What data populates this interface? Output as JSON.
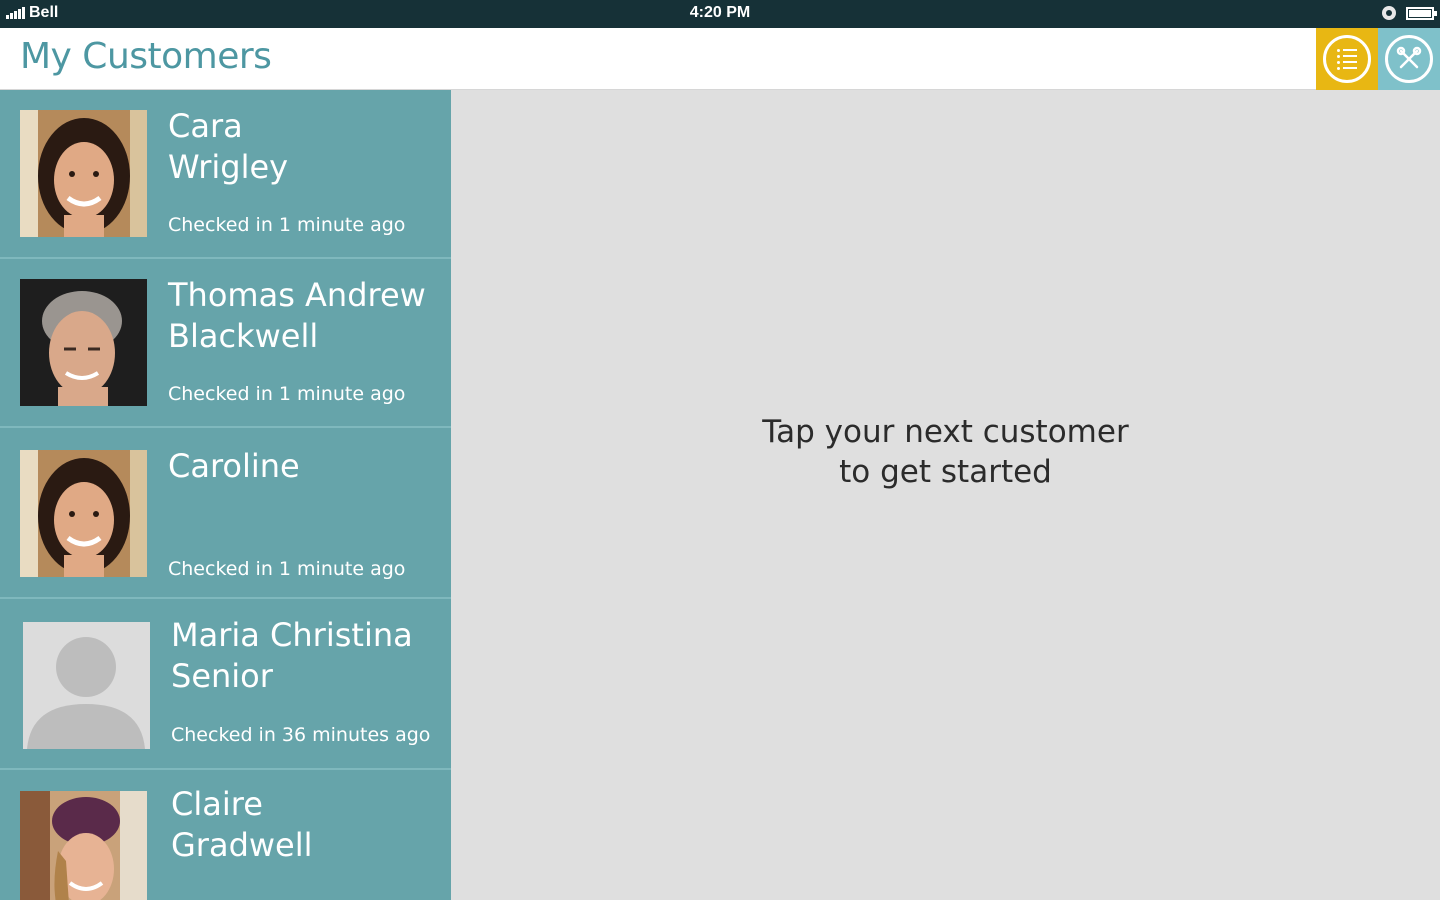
{
  "status_bar": {
    "carrier": "Bell",
    "time": "4:20 PM"
  },
  "header": {
    "title": "My Customers"
  },
  "customers": [
    {
      "first": "Cara",
      "last": "Wrigley",
      "status": "Checked in 1 minute ago",
      "avatar": "woman-brunette-photo"
    },
    {
      "first": "Thomas Andrew",
      "last": "Blackwell",
      "status": "Checked in 1 minute ago",
      "avatar": "man-grey-hair-photo"
    },
    {
      "first": "Caroline",
      "last": "",
      "status": "Checked in 1 minute ago",
      "avatar": "woman-brunette-photo"
    },
    {
      "first": "Maria Christina",
      "last": "Senior",
      "status": "Checked in 36 minutes ago",
      "avatar": "default-person-placeholder"
    },
    {
      "first": "Claire",
      "last": "Gradwell",
      "status": "",
      "avatar": "woman-beanie-photo"
    }
  ],
  "main": {
    "line1": "Tap your next customer",
    "line2": "to get started"
  },
  "colors": {
    "status_bar": "#163137",
    "title": "#4d97a2",
    "sidebar": "#66a4aa",
    "list_button": "#e8b713",
    "tools_button": "#7fc1ca",
    "main_bg": "#dfdfdf"
  }
}
